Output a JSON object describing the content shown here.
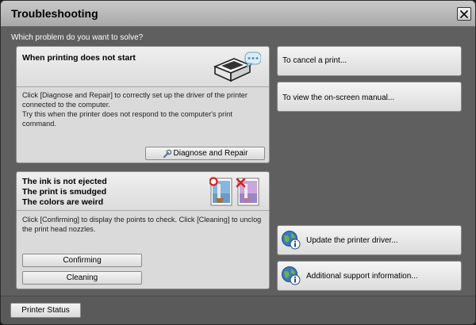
{
  "window": {
    "title": "Troubleshooting",
    "close_icon": "close-icon"
  },
  "question": "Which problem do you want to solve?",
  "print_panel": {
    "title": "When printing does not start",
    "desc_line1": "Click [Diagnose and Repair] to correctly set up the driver of the printer",
    "desc_line2": "connected to the computer.",
    "desc_line3": "Try this when the printer does not respond to the computer's print",
    "desc_line4": "command.",
    "diagnose_label": "Diagnose and Repair",
    "icon": "printer-icon"
  },
  "ink_panel": {
    "title_line1": "The ink is not ejected",
    "title_line2": "The print is smudged",
    "title_line3": "The colors are weird",
    "desc_line1": "Click [Confirming] to display the points to check. Click [Cleaning] to unclog",
    "desc_line2": "the print head nozzles.",
    "confirming_label": "Confirming",
    "cleaning_label": "Cleaning"
  },
  "side": {
    "cancel_label": "To cancel a print...",
    "manual_label": "To view the on-screen manual...",
    "update_label": "Update the printer driver...",
    "support_label": "Additional support information..."
  },
  "footer": {
    "printer_status_label": "Printer Status"
  },
  "colors": {
    "window_bg": "#5f5f5f",
    "panel_bg": "#dadada",
    "globe_blue": "#2f6fb3",
    "ok_red": "#d9201f"
  }
}
